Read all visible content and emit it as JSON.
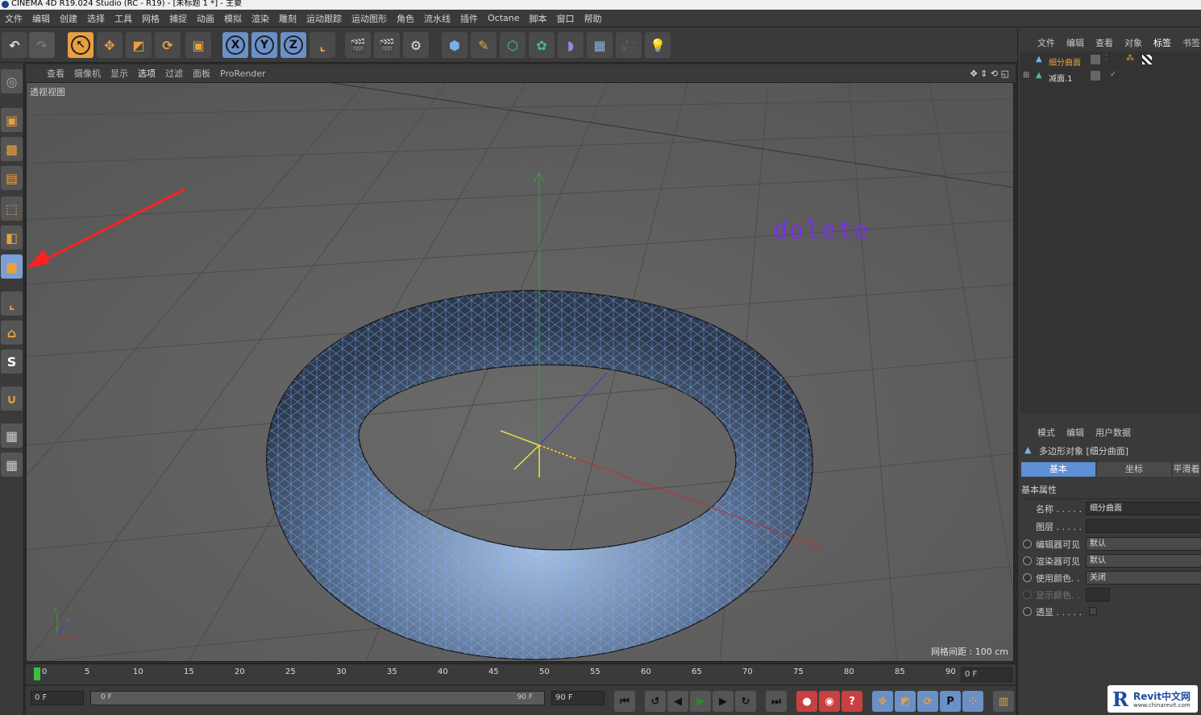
{
  "window": {
    "title": "CINEMA 4D R19.024 Studio (RC - R19) - [未标题 1 *] - 主要"
  },
  "menu": [
    "文件",
    "编辑",
    "创建",
    "选择",
    "工具",
    "网格",
    "捕捉",
    "动画",
    "模拟",
    "渲染",
    "雕刻",
    "运动跟踪",
    "运动图形",
    "角色",
    "流水线",
    "插件",
    "Octane",
    "脚本",
    "窗口",
    "帮助"
  ],
  "toolbar": {
    "x_label": "X",
    "y_label": "Y",
    "z_label": "Z"
  },
  "viewport": {
    "menu": [
      "查看",
      "摄像机",
      "显示",
      "选项",
      "过滤",
      "面板",
      "ProRender"
    ],
    "active_menu": "选项",
    "name": "透视视图",
    "grid_spacing": "网格间距 : 100 cm",
    "annotation": "dolete",
    "accent_colors": {
      "mesh_wire": "#7ab0ff",
      "annotation": "#7a2ee8",
      "arrow": "#ff2020"
    }
  },
  "timeline": {
    "ticks": [
      "0",
      "5",
      "10",
      "15",
      "20",
      "25",
      "30",
      "35",
      "40",
      "45",
      "50",
      "55",
      "60",
      "65",
      "70",
      "75",
      "80",
      "85",
      "90"
    ],
    "current_frame": "0 F"
  },
  "playback": {
    "start_field": "0 F",
    "range_start": "0 F",
    "range_end": "90 F",
    "end_field": "90 F"
  },
  "object_manager": {
    "menu": [
      "文件",
      "编辑",
      "查看",
      "对象",
      "标签",
      "书签"
    ],
    "objects": [
      {
        "name": "细分曲面",
        "selected": true
      },
      {
        "name": "减面.1",
        "selected": false
      }
    ]
  },
  "attribute_manager": {
    "menu": [
      "模式",
      "编辑",
      "用户数据"
    ],
    "object_type": "多边形对象 [细分曲面]",
    "tabs": [
      "基本",
      "坐标",
      "平滑着"
    ],
    "active_tab": "基本",
    "section": "基本属性",
    "props": [
      {
        "label": "名称 . . . . .",
        "value": "细分曲面"
      },
      {
        "label": "图层 . . . . .",
        "value": ""
      },
      {
        "label": "编辑器可见",
        "value": "默认"
      },
      {
        "label": "渲染器可见",
        "value": "默认"
      },
      {
        "label": "使用颜色. .",
        "value": "关闭"
      },
      {
        "label": "显示颜色. .",
        "value": ""
      },
      {
        "label": "透显 . . . . .",
        "value": ""
      }
    ]
  },
  "watermark": {
    "brand": "Revit中文网",
    "url": "www.chinarevit.com"
  }
}
